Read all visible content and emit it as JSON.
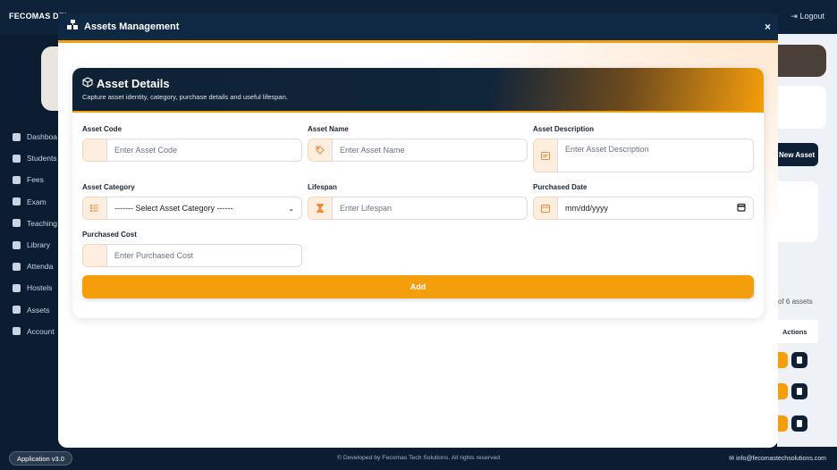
{
  "app": {
    "brand": "FECOMAS DEI",
    "logout_label": "Logout",
    "version": "Application v3.0",
    "footer_text": "© Developed by Fecomas Tech Solutions. All rights reserved",
    "footer_email": "info@fecomastechsolutions.com"
  },
  "sidebar": {
    "items": [
      {
        "label": "Dashboa",
        "icon": "home-icon"
      },
      {
        "label": "Students",
        "icon": "students-icon"
      },
      {
        "label": "Fees",
        "icon": "fees-icon"
      },
      {
        "label": "Exam",
        "icon": "exam-icon"
      },
      {
        "label": "Teaching",
        "icon": "teaching-icon"
      },
      {
        "label": "Library",
        "icon": "library-icon"
      },
      {
        "label": "Attenda",
        "icon": "attendance-icon"
      },
      {
        "label": "Hostels",
        "icon": "hostel-icon"
      },
      {
        "label": "Assets",
        "icon": "assets-icon"
      },
      {
        "label": "Account",
        "icon": "accounts-icon"
      }
    ]
  },
  "background": {
    "new_asset_label": "New Asset",
    "asset_count": "of 6 assets",
    "actions_header": "Actions"
  },
  "modal": {
    "title": "Assets Management",
    "close_label": "×"
  },
  "card": {
    "title": "Asset Details",
    "subtitle": "Capture asset identity, category, purchase details and useful lifespan."
  },
  "form": {
    "asset_code": {
      "label": "Asset Code",
      "placeholder": "Enter Asset Code",
      "value": ""
    },
    "asset_name": {
      "label": "Asset Name",
      "placeholder": "Enter Asset Name",
      "value": ""
    },
    "asset_description": {
      "label": "Asset Description",
      "placeholder": "Enter Asset Description",
      "value": ""
    },
    "asset_category": {
      "label": "Asset Category",
      "selected": "------- Select Asset Category ------"
    },
    "lifespan": {
      "label": "Lifespan",
      "placeholder": "Enter Lifespan",
      "value": ""
    },
    "purchased_date": {
      "label": "Purchased Date",
      "value": "mm/dd/yyyy"
    },
    "purchased_cost": {
      "label": "Purchased Cost",
      "placeholder": "Enter Purchased Cost",
      "value": ""
    },
    "submit_label": "Add"
  },
  "colors": {
    "accent": "#f59e0b",
    "navy": "#0f2844",
    "addon_bg": "#fdeee0"
  }
}
